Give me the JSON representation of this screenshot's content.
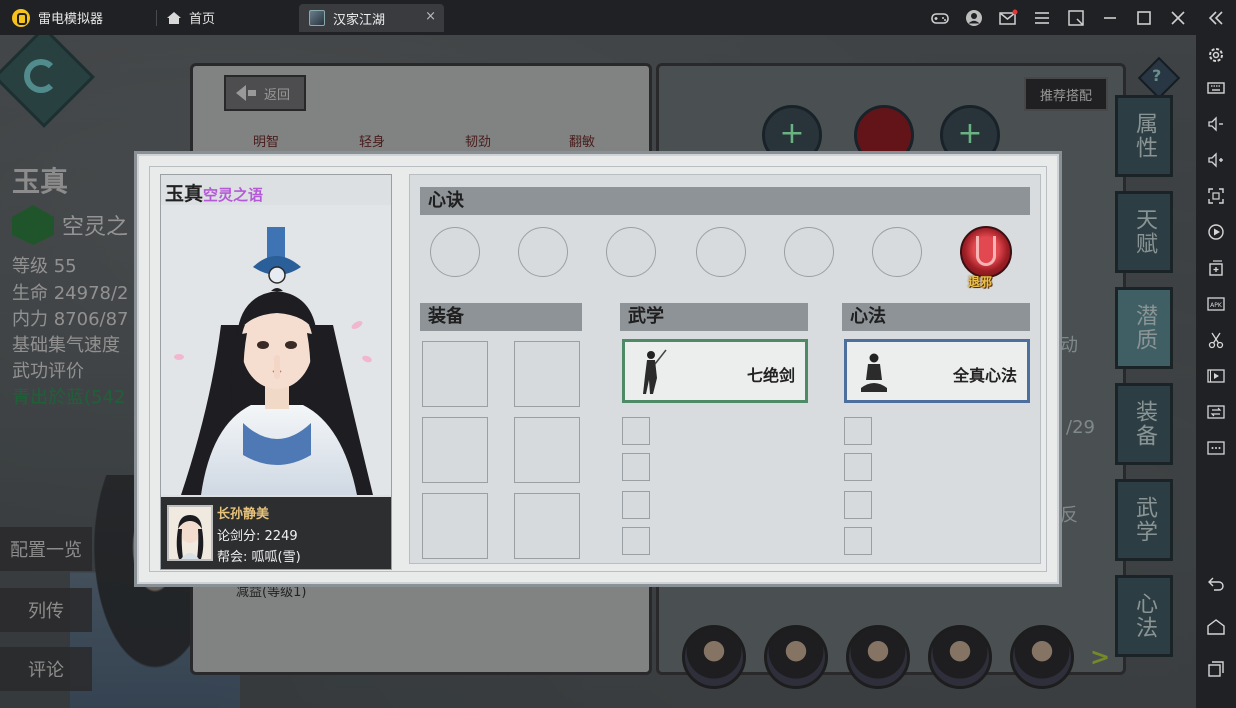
{
  "emulator": {
    "app_title": "雷电模拟器",
    "tabs": [
      {
        "label": "首页"
      },
      {
        "label": "汉家江湖"
      }
    ],
    "close_glyph": "×"
  },
  "game": {
    "bg_character": {
      "name": "玉真",
      "school": "空灵之",
      "stats": [
        "等级 55",
        "生命 24978/2",
        "内力 8706/87",
        "基础集气速度",
        "武功评价"
      ],
      "rating_value": "青出於蓝(542"
    },
    "bg_side_buttons": [
      "配置一览",
      "列传",
      "评论"
    ],
    "bg_book": {
      "return_label": "返回",
      "tabs": [
        "明智",
        "轻身",
        "韧劲",
        "翻敏"
      ],
      "skill_fragment": "减益(等级1)",
      "recommend_label": "推荐搭配",
      "help_glyph": "?",
      "side_tabs": [
        "属性",
        "天赋",
        "潜质",
        "装备",
        "武学",
        "心法"
      ],
      "right_fragments": [
        "动",
        "/29",
        "反"
      ],
      "plus_glyph": "+",
      "next_glyph": ">"
    },
    "modal": {
      "portrait": {
        "name": "玉真",
        "school": "空灵之语",
        "player_name": "长孙静美",
        "score_label": "论剑分:",
        "score_value": "2249",
        "guild_label": "帮会:",
        "guild_value": "呱呱(雪)"
      },
      "sections": {
        "xinjue": "心诀",
        "zhuangbei": "装备",
        "wuxue": "武学",
        "xinfa": "心法"
      },
      "xinjue_equipped_label": "退邪",
      "wuxue_skill": "七绝剑",
      "xinfa_skill": "全真心法"
    }
  },
  "colors": {
    "school_purple": "#b45ad6",
    "wuxue_border": "#4f8a66",
    "xinfa_border": "#4d6f9e",
    "player_gold": "#e7c27a"
  }
}
